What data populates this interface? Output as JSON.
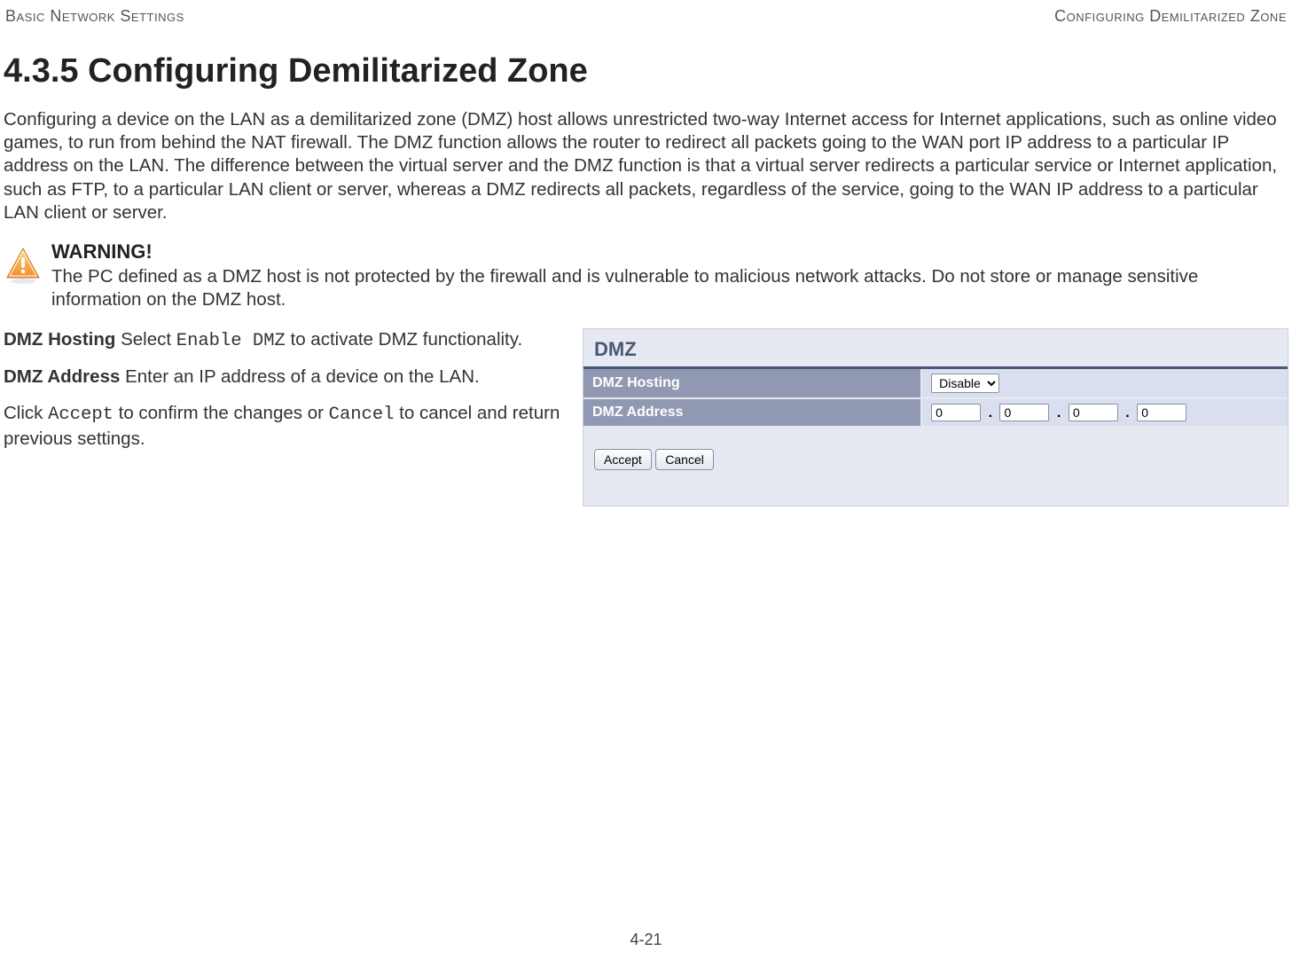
{
  "header": {
    "left": "Basic Network Settings",
    "right": "Configuring Demilitarized Zone"
  },
  "section": {
    "number_title": "4.3.5 Configuring Demilitarized Zone",
    "intro": "Configuring a device on the LAN as a demilitarized zone (DMZ) host allows unrestricted two-way Internet access for Internet applications, such as online video games, to run from behind the NAT firewall. The DMZ function allows the router to redirect all packets going to the WAN port IP address to a particular IP address on the LAN. The difference between the virtual server and the DMZ function is that a virtual server redirects a particular service or Internet application, such as FTP, to a particular LAN client or server, whereas a DMZ redirects all packets, regardless of the service, going to the WAN IP address to a particular LAN client or server."
  },
  "warning": {
    "title": "WARNING!",
    "body": "The PC defined as a DMZ host is not protected by the firewall and is vulnerable to malicious network attacks. Do  not store or manage sensitive information on the DMZ host."
  },
  "defs": {
    "dmz_hosting_label": "DMZ Hosting",
    "dmz_hosting_pre": "  Select ",
    "dmz_hosting_code": "Enable DMZ",
    "dmz_hosting_post": " to activate DMZ functionality.",
    "dmz_address_label": "DMZ Address",
    "dmz_address_body": "  Enter an IP address of a device on the LAN.",
    "click_pre": "Click ",
    "accept_code": "Accept",
    "click_mid": " to confirm the changes or ",
    "cancel_code": "Cancel",
    "click_post": " to cancel and return previous settings."
  },
  "panel": {
    "title": "DMZ",
    "rows": {
      "hosting_label": "DMZ Hosting",
      "hosting_value": "Disable",
      "address_label": "DMZ Address",
      "ip": [
        "0",
        "0",
        "0",
        "0"
      ]
    },
    "buttons": {
      "accept": "Accept",
      "cancel": "Cancel"
    }
  },
  "footer": {
    "page": "4-21"
  }
}
